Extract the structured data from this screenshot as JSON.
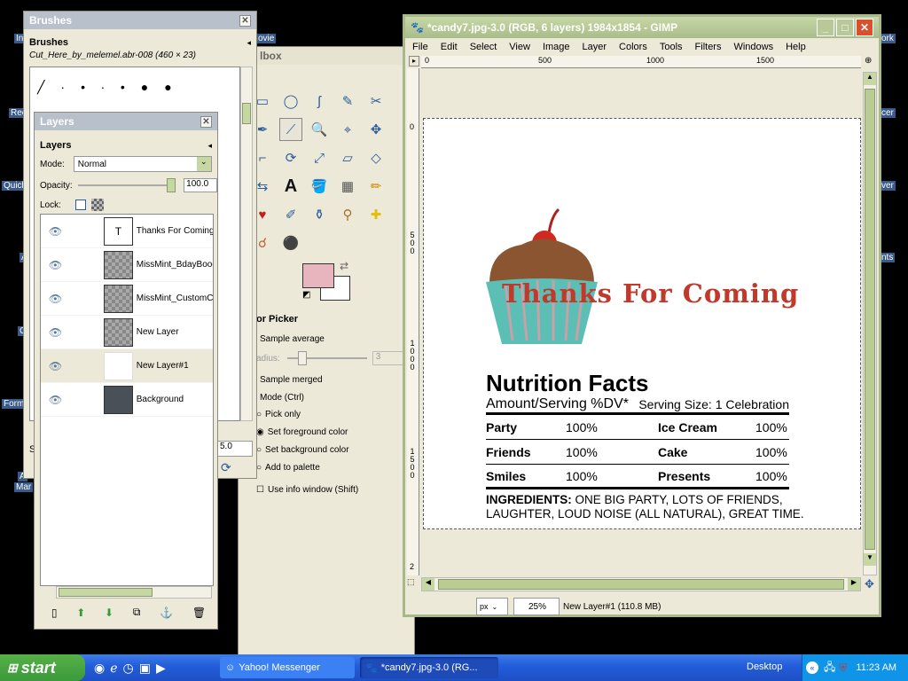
{
  "desktop_labels": [
    "In",
    "Rec",
    "Quick",
    "A",
    "C",
    "Form",
    "A",
    "Mar",
    "ovie",
    "ork",
    "cer",
    "ver",
    "nts"
  ],
  "brushes": {
    "title": "Brushes",
    "header": "Brushes",
    "brush_name": "Cut_Here_by_melemel.abr-008 (460 × 23)"
  },
  "layers": {
    "title": "Layers",
    "header": "Layers",
    "mode_label": "Mode:",
    "mode_value": "Normal",
    "opacity_label": "Opacity:",
    "opacity_value": "100.0",
    "opacity_fraction": 1.0,
    "lock_label": "Lock:",
    "items": [
      {
        "name": "Thanks For Coming",
        "thumb": "text"
      },
      {
        "name": "MissMint_BdayBoogi",
        "thumb": "checker"
      },
      {
        "name": "MissMint_CustomCar",
        "thumb": "checker"
      },
      {
        "name": "New Layer",
        "thumb": "checker"
      },
      {
        "name": "New Layer#1",
        "thumb": "white",
        "selected": true
      },
      {
        "name": "Background",
        "thumb": "dark"
      }
    ],
    "footer_icons": [
      "new-layer-icon",
      "raise-layer-icon",
      "lower-layer-icon",
      "duplicate-layer-icon",
      "anchor-layer-icon",
      "delete-layer-icon"
    ]
  },
  "brush_spacing_value": "5.0",
  "brush_spacing_label": "S",
  "toolbox": {
    "title": "lbox",
    "color_picker": {
      "title": "or Picker",
      "sample_average": "Sample average",
      "radius_label": "adius:",
      "radius_value": "3",
      "sample_merged": "Sample merged",
      "mode_label": "Mode  (Ctrl)",
      "pick_only": "Pick only",
      "set_fg": "Set foreground color",
      "set_bg": "Set background color",
      "add_palette": "Add to palette",
      "use_info": "Use info window  (Shift)"
    },
    "fg_color": "#e8b4be",
    "bg_color": "#ffffff"
  },
  "gimp": {
    "title": "*candy7.jpg-3.0 (RGB, 6 layers) 1984x1854 - GIMP",
    "menu": [
      "File",
      "Edit",
      "Select",
      "View",
      "Image",
      "Layer",
      "Colors",
      "Tools",
      "Filters",
      "Windows",
      "Help"
    ],
    "ruler_h": [
      "0",
      "500",
      "1000",
      "1500"
    ],
    "ruler_v": [
      "0",
      "500",
      "1000",
      "1500",
      "2"
    ],
    "unit": "px",
    "zoom": "25%",
    "status": "New Layer#1 (110.8 MB)"
  },
  "canvas": {
    "headline": "Thanks For Coming",
    "nf_title": "Nutrition Facts",
    "nf_sub_left": "Amount/Serving %DV*",
    "nf_sub_right": "Serving Size: 1 Celebration",
    "rows": [
      {
        "a": "Party",
        "av": "100%",
        "b": "Ice Cream",
        "bv": "100%"
      },
      {
        "a": "Friends",
        "av": "100%",
        "b": "Cake",
        "bv": "100%"
      },
      {
        "a": "Smiles",
        "av": "100%",
        "b": "Presents",
        "bv": "100%"
      }
    ],
    "ing_label": "INGREDIENTS:",
    "ing_text": " ONE BIG  PARTY, LOTS OF FRIENDS,",
    "ing_text2": "LAUGHTER, LOUD NOISE (ALL NATURAL), GREAT TIME."
  },
  "taskbar": {
    "start": "start",
    "tasks": [
      "Yahoo! Messenger",
      "*candy7.jpg-3.0 (RG..."
    ],
    "desktop": "Desktop",
    "clock": "11:23 AM"
  },
  "colors": {
    "headline": "#c0392b",
    "teal": "#5bbfb5",
    "brown": "#7a4a2a",
    "taskbar": "#245edb",
    "start": "#3c9a3c"
  }
}
